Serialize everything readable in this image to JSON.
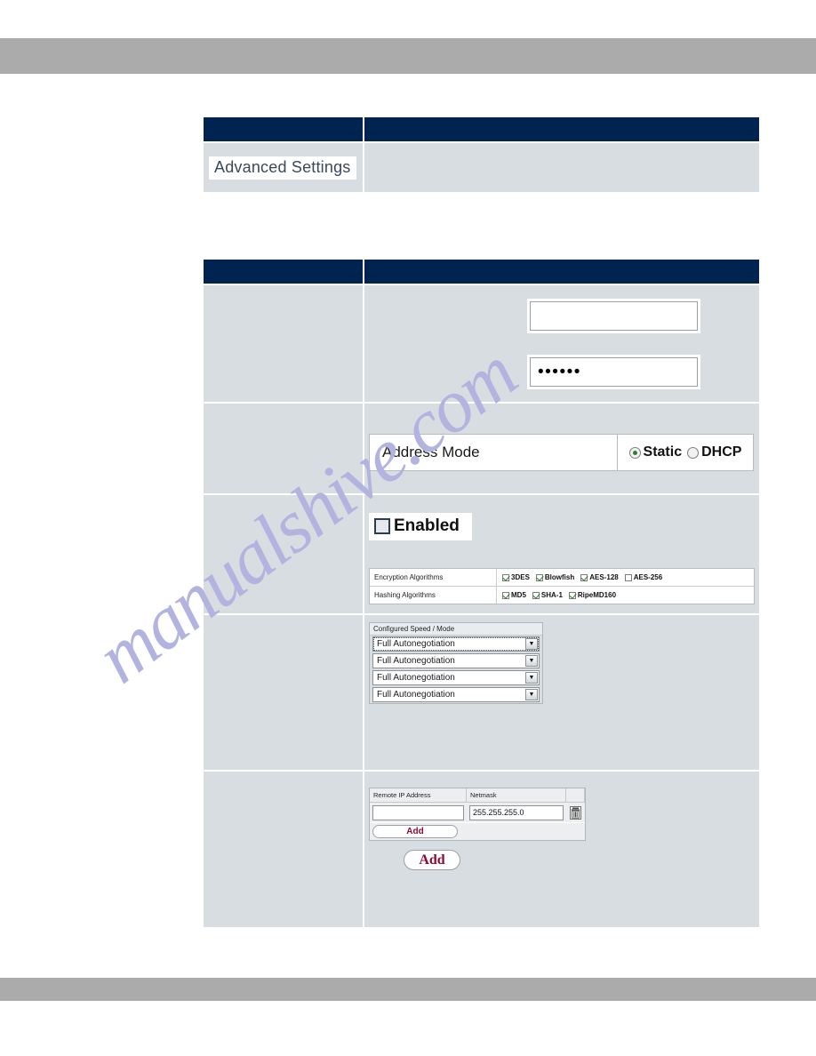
{
  "page": {
    "top_band_color": "#ababab",
    "bottom_band_color": "#ababab",
    "watermark": "manualshive.com",
    "watermark_color": "#b3b3e0"
  },
  "theme": {
    "header_navy": "#00234f",
    "cell_bluegray": "#d7dde1",
    "button_red": "#8d0b33",
    "radio_green": "#2f7d32"
  },
  "table_one": {
    "advanced_settings_label": "Advanced Settings"
  },
  "table_two": {
    "credentials": {
      "username_value": "",
      "password_value": "••••••"
    },
    "address_mode": {
      "label": "Address Mode",
      "options": [
        {
          "label": "Static",
          "selected": true
        },
        {
          "label": "DHCP",
          "selected": false
        }
      ]
    },
    "security": {
      "enabled_label": "Enabled",
      "enabled_checked": false,
      "algorithms": [
        {
          "name": "Encryption Algorithms",
          "options": [
            {
              "label": "3DES",
              "checked": true
            },
            {
              "label": "Blowfish",
              "checked": true
            },
            {
              "label": "AES-128",
              "checked": true
            },
            {
              "label": "AES-256",
              "checked": false
            }
          ]
        },
        {
          "name": "Hashing Algorithms",
          "options": [
            {
              "label": "MD5",
              "checked": true
            },
            {
              "label": "SHA-1",
              "checked": true
            },
            {
              "label": "RipeMD160",
              "checked": true
            }
          ]
        }
      ]
    },
    "speed": {
      "header": "Configured Speed / Mode",
      "rows": [
        {
          "value": "Full Autonegotiation",
          "focused": true
        },
        {
          "value": "Full Autonegotiation",
          "focused": false
        },
        {
          "value": "Full Autonegotiation",
          "focused": false
        },
        {
          "value": "Full Autonegotiation",
          "focused": false
        }
      ],
      "arrow_glyph": "▼"
    },
    "remote": {
      "columns": [
        "Remote IP Address",
        "Netmask"
      ],
      "rows": [
        {
          "ip": "",
          "netmask": "255.255.255.0"
        }
      ],
      "add_row_label": "Add",
      "add_block_label": "Add",
      "row_delete_icon": "trash-icon",
      "section_delete_icon": "trash-icon"
    }
  }
}
